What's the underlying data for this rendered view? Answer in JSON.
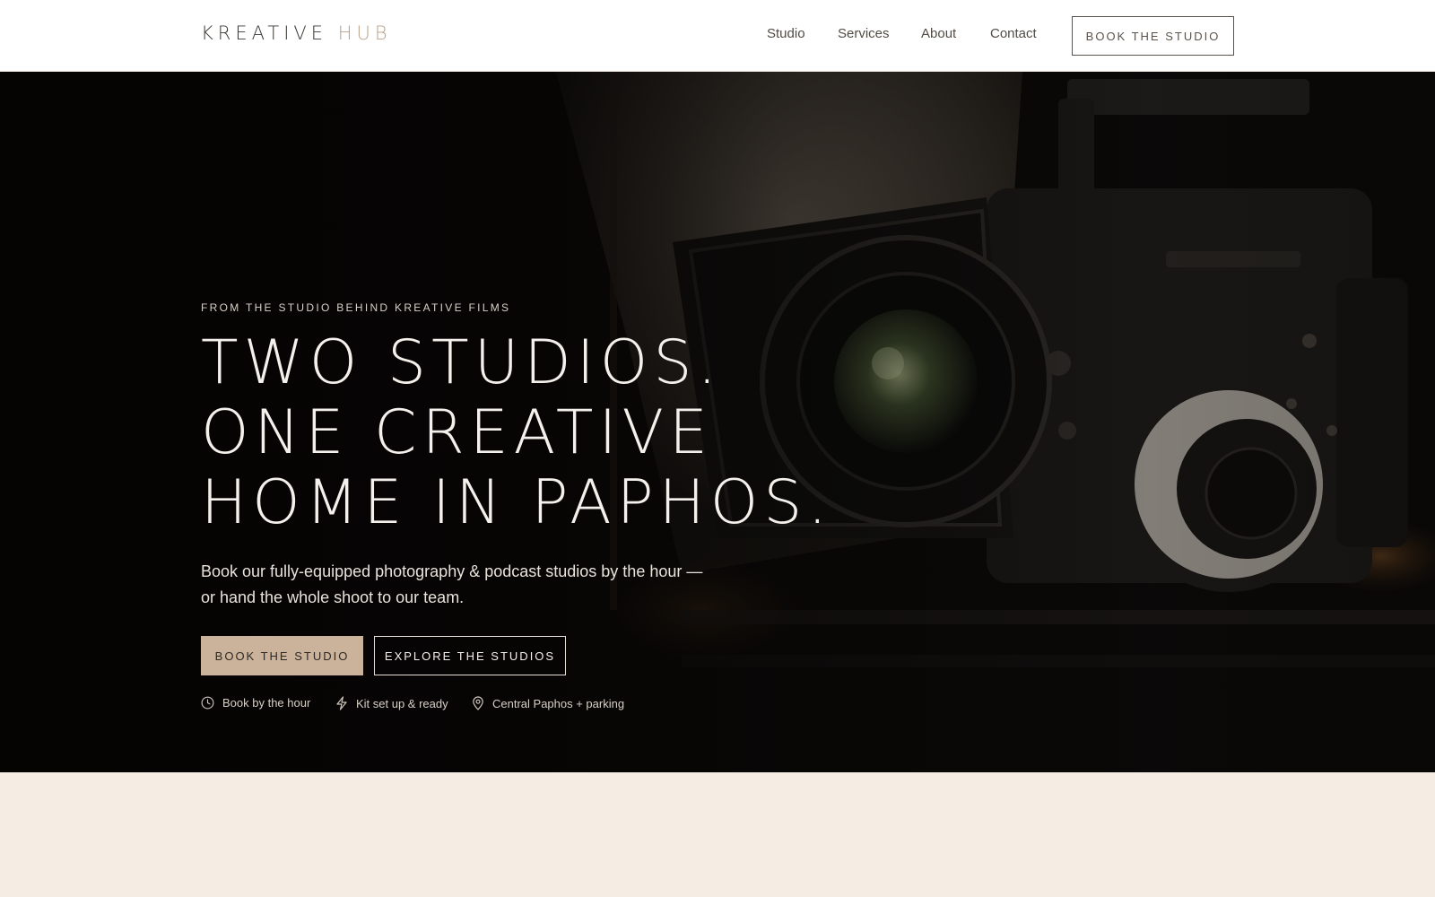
{
  "header": {
    "logo_main": "KREATIVE",
    "logo_accent": "HUB",
    "nav": [
      "Studio",
      "Services",
      "About",
      "Contact"
    ],
    "cta_label": "BOOK THE STUDIO"
  },
  "hero": {
    "eyebrow": "FROM THE STUDIO BEHIND KREATIVE FILMS",
    "headline": [
      "TWO STUDIOS.",
      "ONE CREATIVE",
      "HOME IN PAPHOS."
    ],
    "subcopy_lines": [
      "Book our fully-equipped photography & podcast studios by the hour —",
      "or hand the whole shoot to our team."
    ],
    "primary_cta": "BOOK THE STUDIO",
    "secondary_cta": "EXPLORE THE STUDIOS",
    "features": [
      {
        "icon": "clock-icon",
        "label": "Book by the hour"
      },
      {
        "icon": "lightning-icon",
        "label": "Kit set up & ready"
      },
      {
        "icon": "map-pin-icon",
        "label": "Central Paphos + parking"
      }
    ]
  },
  "colors": {
    "accent": "#cbb29a",
    "logo_accent": "#b9a089",
    "hero_bg": "#0a0807",
    "section_bg": "#f5ede3"
  }
}
